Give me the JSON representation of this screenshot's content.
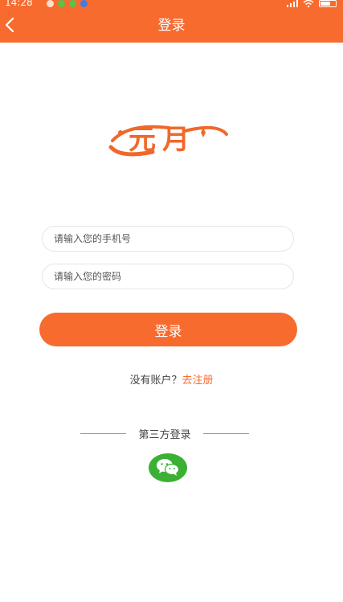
{
  "status_bar": {
    "time": "14:28"
  },
  "header": {
    "title": "登录"
  },
  "form": {
    "phone_placeholder": "请输入您的手机号",
    "password_placeholder": "请输入您的密码",
    "phone_value": "",
    "password_value": ""
  },
  "login_button": {
    "label": "登录"
  },
  "register": {
    "prompt": "没有账户？",
    "link": "去注册"
  },
  "third_party": {
    "label": "第三方登录"
  },
  "colors": {
    "brand": "#f76b2f",
    "wechat": "#3cb034"
  },
  "icons": {
    "back": "chevron-left-icon",
    "wechat": "wechat-icon",
    "logo": "app-logo"
  }
}
